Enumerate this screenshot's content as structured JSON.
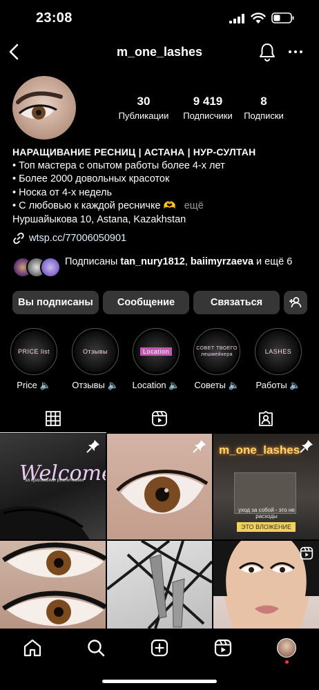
{
  "status_bar": {
    "time": "23:08"
  },
  "header": {
    "username": "m_one_lashes"
  },
  "stats": [
    {
      "value": "30",
      "label": "Публикации"
    },
    {
      "value": "9 419",
      "label": "Подписчики"
    },
    {
      "value": "8",
      "label": "Подписки"
    }
  ],
  "bio": {
    "name": "НАРАЩИВАНИЕ РЕСНИЦ | АСТАНА | НУР-СУЛТАН",
    "lines": [
      "• Топ мастера с опытом работы более 4-х лет",
      "• Более 2000 довольных красоток",
      "• Носка от 4-х недель",
      "• С любовью к каждой ресничке 🫶"
    ],
    "more": "ещё",
    "address": "Нуршайыкова 10, Astana, Kazakhstan"
  },
  "link": {
    "text": "wtsp.cc/77006050901"
  },
  "followed_by": {
    "prefix": "Подписаны ",
    "user1": "tan_nury1812",
    "sep": ", ",
    "user2": "baiimyrzaeva",
    "suffix": " и ещё 6"
  },
  "buttons": {
    "following": "Вы подписаны",
    "message": "Сообщение",
    "contact": "Связаться"
  },
  "highlights": [
    {
      "label": "Price 🔈",
      "cover": "PRICE list"
    },
    {
      "label": "Отзывы 🔈",
      "cover": "Отзывы"
    },
    {
      "label": "Location 🔈",
      "cover": "Location"
    },
    {
      "label": "Советы 🔈",
      "cover": "СОВЕТ ТВОЕГО лешмейкера"
    },
    {
      "label": "Работы 🔈",
      "cover": "LASHES"
    }
  ],
  "posts": {
    "p1_title": "Welcome",
    "p1_sub": "за красивыми ресничками",
    "p3_sign": "m_one_lashes",
    "p3_text": "уход за собой - это не расходы",
    "p3_badge": "ЭТО ВЛОЖЕНИЕ"
  },
  "colors": {
    "background": "#000000",
    "button": "#363636",
    "link": "#e0f1ff",
    "badge": "#f2d25a"
  },
  "icons": [
    "back-icon",
    "bell-icon",
    "more-icon",
    "link-icon",
    "add-person-icon",
    "grid-icon",
    "reels-icon",
    "tagged-icon",
    "pin-icon",
    "home-icon",
    "search-icon",
    "create-icon",
    "reels-nav-icon"
  ]
}
